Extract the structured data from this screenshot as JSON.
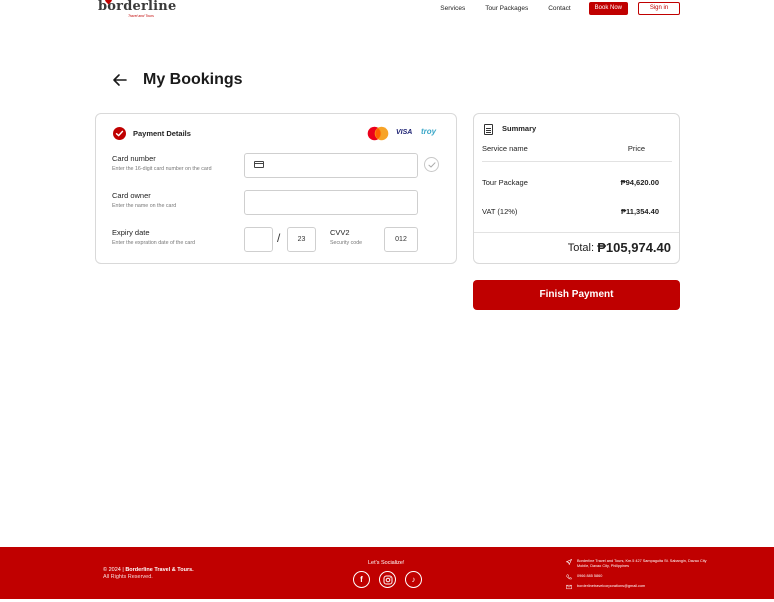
{
  "brand": {
    "logo_text": "borderline",
    "logo_tagline": "Travel and Tours",
    "accent": "#c00000"
  },
  "nav": {
    "services": "Services",
    "tour_packages": "Tour Packages",
    "contact": "Contact",
    "book_now": "Book Now",
    "sign_in": "Sign in"
  },
  "page": {
    "title": "My Bookings"
  },
  "payment": {
    "title": "Payment Details",
    "brands": {
      "visa": "VISA",
      "troy": "troy"
    },
    "card_number": {
      "label": "Card number",
      "hint": "Enter the 16-digit card number on the card",
      "value": ""
    },
    "card_owner": {
      "label": "Card owner",
      "hint": "Enter the name on the card",
      "value": ""
    },
    "expiry": {
      "label": "Expiry date",
      "hint": "Enter the expration date of the card",
      "month": "",
      "separator": "/",
      "year": "23"
    },
    "cvv": {
      "label": "CVV2",
      "hint": "Security code",
      "value": "012"
    }
  },
  "summary": {
    "title": "Summary",
    "col_service": "Service name",
    "col_price": "Price",
    "rows": [
      {
        "name": "Tour Package",
        "price": "₱94,620.00"
      },
      {
        "name": "VAT (12%)",
        "price": "₱11,354.40"
      }
    ],
    "total_label": "Total:",
    "total_value": "₱105,974.40"
  },
  "finish_button": "Finish Payment",
  "footer": {
    "copyright_prefix": "© 2024 |",
    "company": "Borderline Travel & Tours.",
    "rights": "All Rights Reserved.",
    "social_title": "Let's Socialize!",
    "address": "Borderline Travel and Tours, Km.5 427 Sampaguita St. Sabangin, Davao City Mobile, Davao City, Philippines",
    "phone": "0966 885 5860",
    "email": "borderlinetravelcorporations@gmail.com"
  }
}
